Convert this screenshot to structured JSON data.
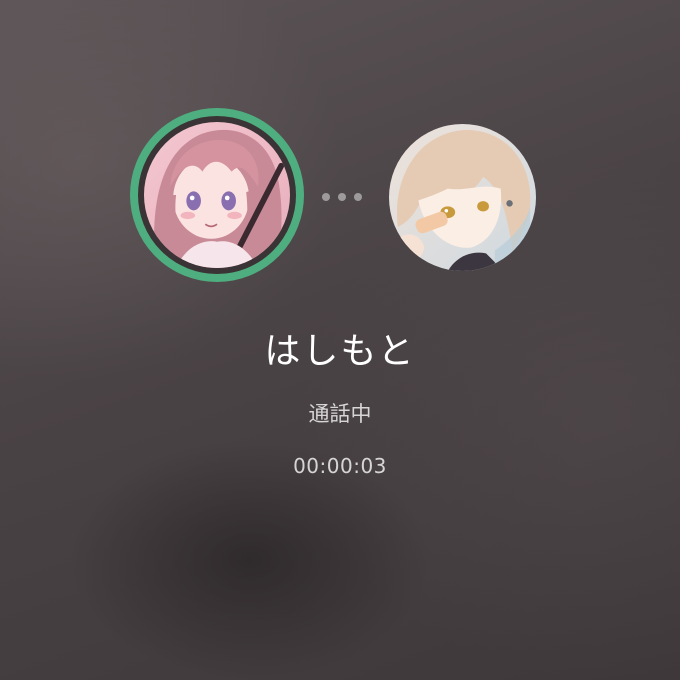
{
  "call": {
    "caller_name": "はしもと",
    "status": "通話中",
    "duration": "00:00:03"
  },
  "avatars": {
    "self": {
      "icon": "anime-girl-pink-hair-avatar",
      "active_ring_color": "#4fae7f"
    },
    "remote": {
      "icon": "anime-girl-blonde-hair-avatar"
    }
  },
  "connection": {
    "icon": "connecting-dots-icon"
  }
}
